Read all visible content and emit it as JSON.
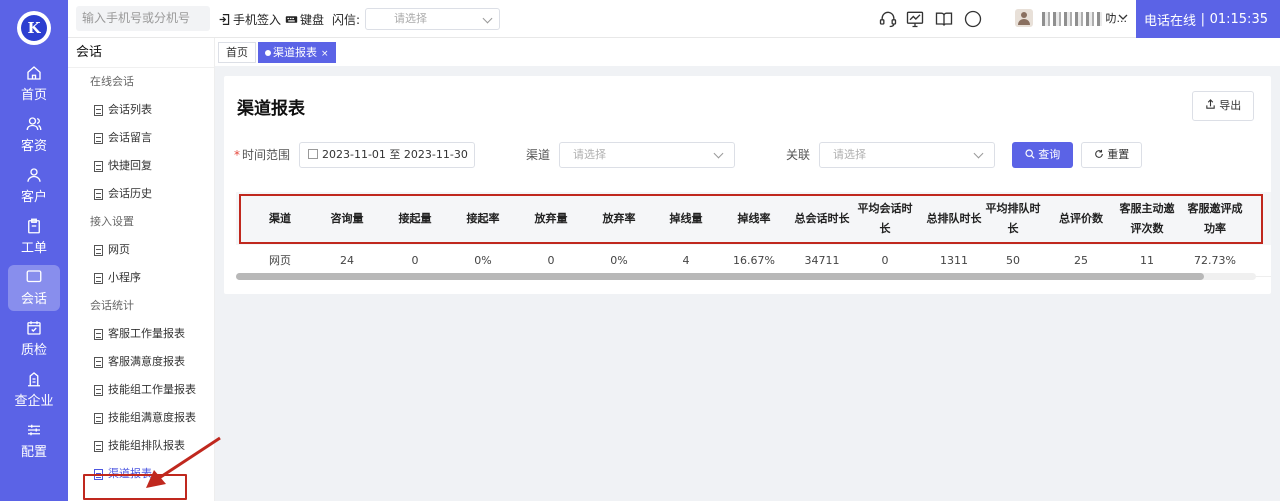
{
  "rail": {
    "items": [
      {
        "label": "首页",
        "icon": "home-icon"
      },
      {
        "label": "客资",
        "icon": "users-icon"
      },
      {
        "label": "客户",
        "icon": "user-icon"
      },
      {
        "label": "工单",
        "icon": "clipboard-icon"
      },
      {
        "label": "会话",
        "icon": "chat-icon",
        "active": true
      },
      {
        "label": "质检",
        "icon": "calendar-check-icon"
      },
      {
        "label": "查企业",
        "icon": "building-icon"
      },
      {
        "label": "配置",
        "icon": "sliders-icon"
      }
    ]
  },
  "topbar": {
    "search_placeholder": "输入手机号或分机号",
    "phone_signin": "手机签入",
    "keyboard": "键盘",
    "flash_label": "闪信:",
    "flash_placeholder": "请选择",
    "user_suffix": "叻...",
    "phone_status": "电话在线",
    "separator": "|",
    "timer": "01:15:35"
  },
  "subnav": {
    "title": "会话",
    "groups": [
      {
        "title": "在线会话",
        "items": [
          "会话列表",
          "会话留言",
          "快捷回复",
          "会话历史"
        ]
      },
      {
        "title": "接入设置",
        "items": [
          "网页",
          "小程序"
        ]
      },
      {
        "title": "会话统计",
        "items": [
          "客服工作量报表",
          "客服满意度报表",
          "技能组工作量报表",
          "技能组满意度报表",
          "技能组排队报表",
          "渠道报表"
        ]
      }
    ],
    "active_item": "渠道报表"
  },
  "tabs": {
    "home": "首页",
    "active": "渠道报表",
    "close": "×"
  },
  "report": {
    "title": "渠道报表",
    "export": "导出",
    "filters": {
      "time_label": "时间范围",
      "required_mark": "*",
      "date_range": "2023-11-01 至 2023-11-30",
      "channel_label": "渠道",
      "channel_placeholder": "请选择",
      "relation_label": "关联",
      "relation_placeholder": "请选择",
      "query": "查询",
      "reset": "重置"
    },
    "columns": [
      "渠道",
      "咨询量",
      "接起量",
      "接起率",
      "放弃量",
      "放弃率",
      "掉线量",
      "掉线率",
      "总会话时长",
      "平均会话时长",
      "总排队时长",
      "平均排队时长",
      "总评价数",
      "客服主动邀评次数",
      "客服邀评成功率"
    ],
    "rows": [
      [
        "网页",
        "24",
        "0",
        "0%",
        "0",
        "0%",
        "4",
        "16.67%",
        "34711",
        "0",
        "1311",
        "50",
        "25",
        "11",
        "72.73%"
      ]
    ]
  }
}
